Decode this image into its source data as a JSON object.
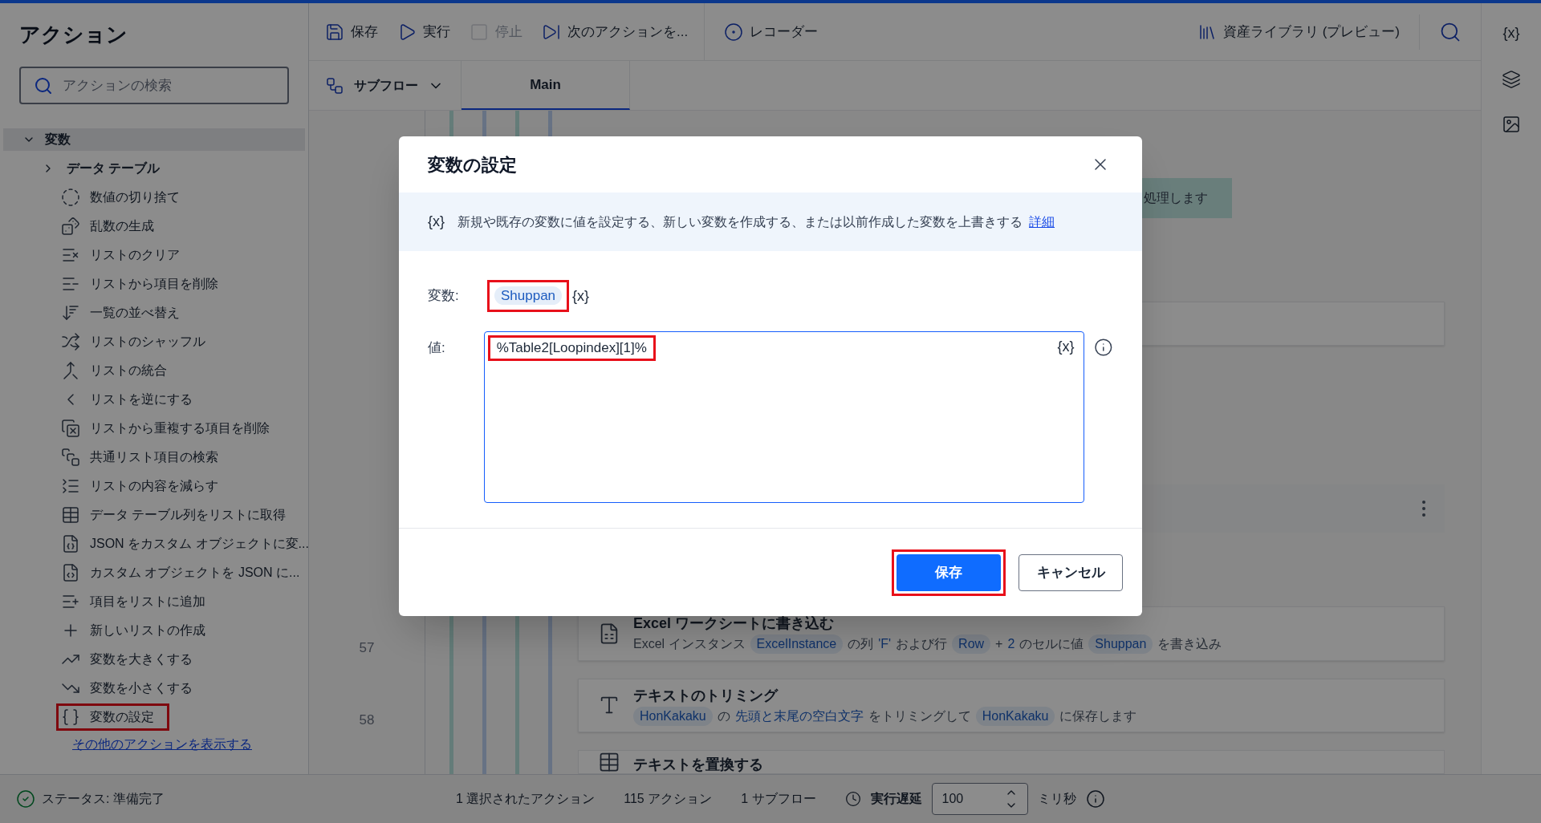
{
  "sidebar": {
    "title": "アクション",
    "search": {
      "placeholder": "アクションの検索"
    },
    "group": {
      "label": "変数",
      "expanded": true,
      "children": [
        {
          "label": "データ テーブル",
          "kind": "folder",
          "expanded": false,
          "highlighted": false
        },
        {
          "label": "数値の切り捨て",
          "kind": "action",
          "highlighted": false
        },
        {
          "label": "乱数の生成",
          "kind": "action",
          "highlighted": false
        },
        {
          "label": "リストのクリア",
          "kind": "action",
          "highlighted": false
        },
        {
          "label": "リストから項目を削除",
          "kind": "action",
          "highlighted": false
        },
        {
          "label": "一覧の並べ替え",
          "kind": "action",
          "highlighted": false
        },
        {
          "label": "リストのシャッフル",
          "kind": "action",
          "highlighted": false
        },
        {
          "label": "リストの統合",
          "kind": "action",
          "highlighted": false
        },
        {
          "label": "リストを逆にする",
          "kind": "action",
          "highlighted": false
        },
        {
          "label": "リストから重複する項目を削除",
          "kind": "action",
          "highlighted": false
        },
        {
          "label": "共通リスト項目の検索",
          "kind": "action",
          "highlighted": false
        },
        {
          "label": "リストの内容を減らす",
          "kind": "action",
          "highlighted": false
        },
        {
          "label": "データ テーブル列をリストに取得",
          "kind": "action",
          "highlighted": false
        },
        {
          "label": "JSON をカスタム オブジェクトに変...",
          "kind": "action",
          "highlighted": false
        },
        {
          "label": "カスタム オブジェクトを JSON に...",
          "kind": "action",
          "highlighted": false
        },
        {
          "label": "項目をリストに追加",
          "kind": "action",
          "highlighted": false
        },
        {
          "label": "新しいリストの作成",
          "kind": "action",
          "highlighted": false
        },
        {
          "label": "変数を大きくする",
          "kind": "action",
          "highlighted": false
        },
        {
          "label": "変数を小さくする",
          "kind": "action",
          "highlighted": false
        },
        {
          "label": "変数の設定",
          "kind": "action",
          "highlighted": true
        }
      ]
    },
    "more_link": "その他のアクションを表示する"
  },
  "toolbar": {
    "items": [
      {
        "label": "保存",
        "disabled": false
      },
      {
        "label": "実行",
        "disabled": false
      },
      {
        "label": "停止",
        "disabled": true
      },
      {
        "label": "次のアクションを...",
        "disabled": false
      }
    ],
    "recorder": "レコーダー",
    "asset_library": "資産ライブラリ (プレビュー)"
  },
  "tabs": {
    "subflow": "サブフロー",
    "items": [
      {
        "label": "Main",
        "selected": true
      }
    ]
  },
  "right_rail": {
    "variables": "{x}"
  },
  "canvas": {
    "partial_card": "処理します",
    "rows": [
      {
        "number": "57",
        "title": "Excel ワークシートに書き込む",
        "parts": [
          {
            "text": "Excel インスタンス",
            "kind": "plain"
          },
          {
            "text": "ExcelInstance",
            "kind": "var"
          },
          {
            "text": "の列",
            "kind": "plain"
          },
          {
            "text": "'F'",
            "kind": "literal"
          },
          {
            "text": "および行",
            "kind": "plain"
          },
          {
            "text": "Row",
            "kind": "var"
          },
          {
            "text": "+",
            "kind": "plain"
          },
          {
            "text": "2",
            "kind": "literal"
          },
          {
            "text": "のセルに値",
            "kind": "plain"
          },
          {
            "text": "Shuppan",
            "kind": "var"
          },
          {
            "text": "を書き込み",
            "kind": "plain"
          }
        ]
      },
      {
        "number": "58",
        "title": "テキストのトリミング",
        "parts": [
          {
            "text": "HonKakaku",
            "kind": "var"
          },
          {
            "text": "の",
            "kind": "plain"
          },
          {
            "text": "先頭と末尾の空白文字",
            "kind": "literal"
          },
          {
            "text": "をトリミングして",
            "kind": "plain"
          },
          {
            "text": "HonKakaku",
            "kind": "var"
          },
          {
            "text": "に保存します",
            "kind": "plain"
          }
        ]
      }
    ],
    "partial_title": "テキストを置換する"
  },
  "dialog": {
    "title": "変数の設定",
    "info_icon": "{x}",
    "info": "新規や既存の変数に値を設定する、新しい変数を作成する、または以前作成した変数を上書きする",
    "info_link": "詳細",
    "variable": {
      "label": "変数:",
      "value": "Shuppan",
      "button": "{x}",
      "highlighted": true
    },
    "value": {
      "label": "値:",
      "value": "%Table2[Loopindex][1]%",
      "button": "{x}",
      "highlighted": true
    },
    "save": {
      "label": "保存",
      "highlighted": true
    },
    "cancel": {
      "label": "キャンセル"
    }
  },
  "status_bar": {
    "status": "ステータス: 準備完了",
    "selected": "1 選択されたアクション",
    "actions": "115 アクション",
    "subflows": "1 サブフロー",
    "delay_label": "実行遅延",
    "delay_value": "100",
    "unit": "ミリ秒"
  }
}
